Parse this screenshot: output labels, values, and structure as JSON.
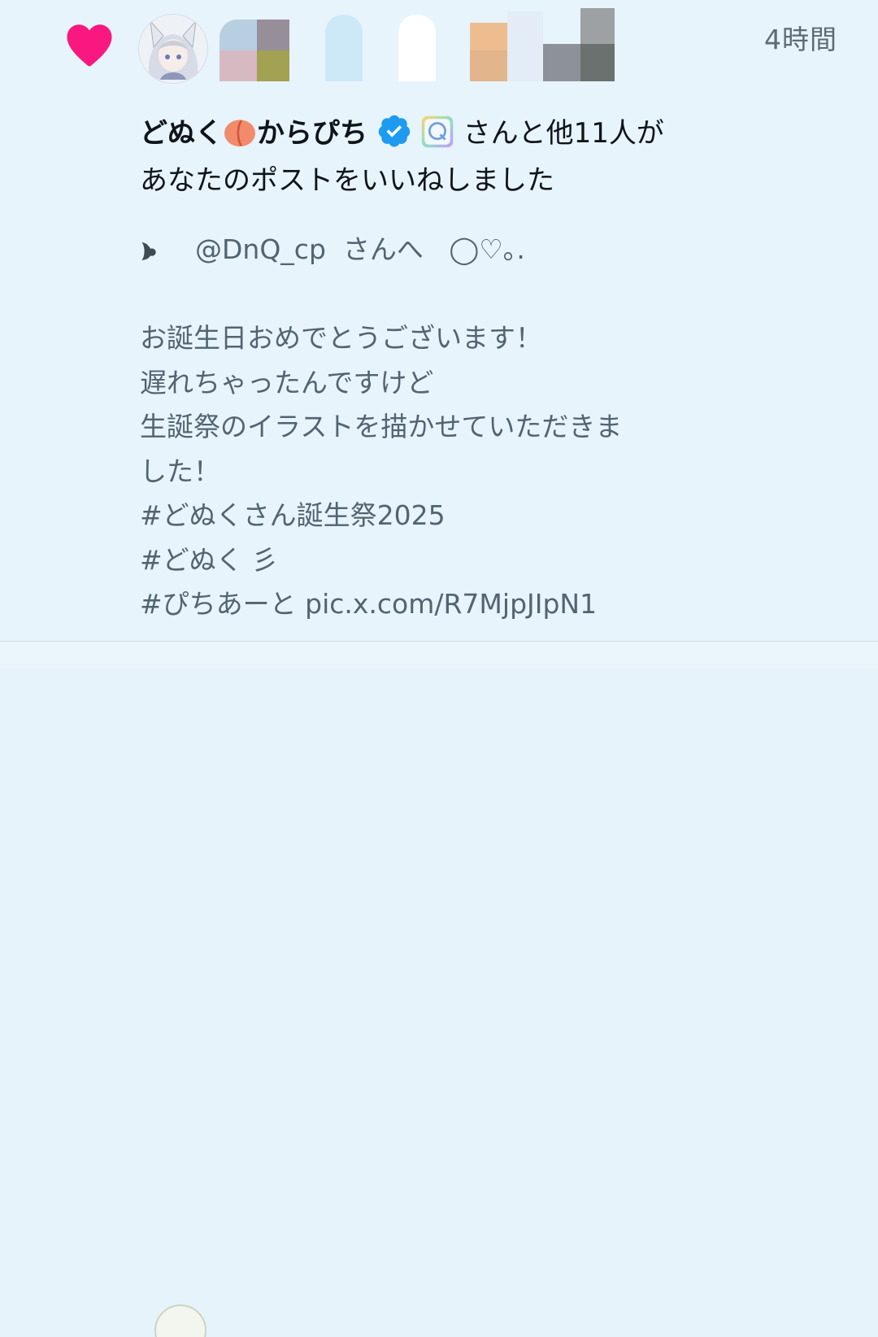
{
  "timestamp": "4時間",
  "notification": {
    "actor_name_part1": "どぬく",
    "actor_name_part2": "からぴち",
    "actor_suffix": "さんと他11人が",
    "action_text": "あなたのポストをいいねしました"
  },
  "post": {
    "reply_to_handle": "@DnQ_cp",
    "reply_to_suffix": "さんへ",
    "reply_to_deco": "◯♡｡.",
    "lines": [
      "お誕生日おめでとうございます！",
      "遅れちゃったんですけど",
      "生誕祭のイラストを描かせていただきま",
      "した！",
      "#どぬくさん誕生祭2025",
      "#どぬく 彡",
      "#ぴちあーと pic.x.com/R7MjpJIpN1"
    ]
  },
  "colors": {
    "like_heart": "#f91880",
    "verified_badge": "#1d9bf0",
    "background": "#e7f4fc",
    "body_text": "#536471",
    "headline_text": "#0f1419"
  },
  "icons": [
    "heart-icon",
    "verified-badge-icon",
    "peach-emoji-icon",
    "q-emoji-icon",
    "bullet-heart-icon"
  ]
}
